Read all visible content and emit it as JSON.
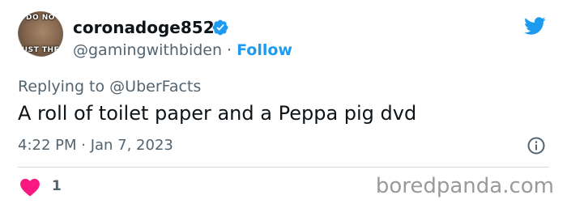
{
  "author": {
    "avatar_top_text": "DO NO",
    "avatar_bottom_text": "UST THE",
    "display_name": "coronadoge852",
    "handle": "@gamingwithbiden",
    "separator": "·",
    "follow_label": "Follow",
    "verified_icon": "verified-badge",
    "brand_color": "#1d9bf0"
  },
  "tweet": {
    "replying_label": "Replying to",
    "replying_to": "@UberFacts",
    "text": "A roll of toilet paper and a Peppa pig dvd",
    "timestamp": "4:22 PM · Jan 7, 2023"
  },
  "footer": {
    "like_icon": "heart-icon",
    "like_color": "#f91880",
    "like_count": "1",
    "watermark": "boredpanda.com"
  }
}
